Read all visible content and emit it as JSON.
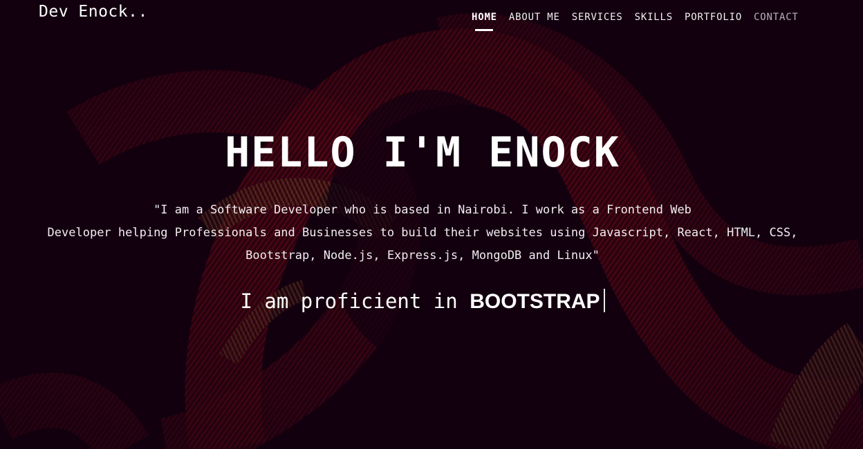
{
  "nav": {
    "brand": "Dev Enock..",
    "links": [
      {
        "label": "HOME",
        "state": "active"
      },
      {
        "label": "ABOUT ME",
        "state": "normal"
      },
      {
        "label": "SERVICES",
        "state": "normal"
      },
      {
        "label": "SKILLS",
        "state": "normal"
      },
      {
        "label": "PORTFOLIO",
        "state": "normal"
      },
      {
        "label": "CONTACT",
        "state": "dim"
      }
    ]
  },
  "hero": {
    "title": "HELLO I'M ENOCK",
    "description_lines": [
      "\"I am a Software Developer who is based in Nairobi. I work as a Frontend Web",
      "Developer helping Professionals and Businesses to build their websites using Javascript, React, HTML, CSS,",
      "Bootstrap, Node.js, Express.js, MongoDB and Linux\""
    ],
    "typed_prefix": "I am proficient in",
    "typed_word": "BOOTSTRAP"
  },
  "colors": {
    "background": "#12010f",
    "light_trail": "#b3101a",
    "light_trail_highlight": "#c9b24a",
    "text": "#ffffff"
  }
}
